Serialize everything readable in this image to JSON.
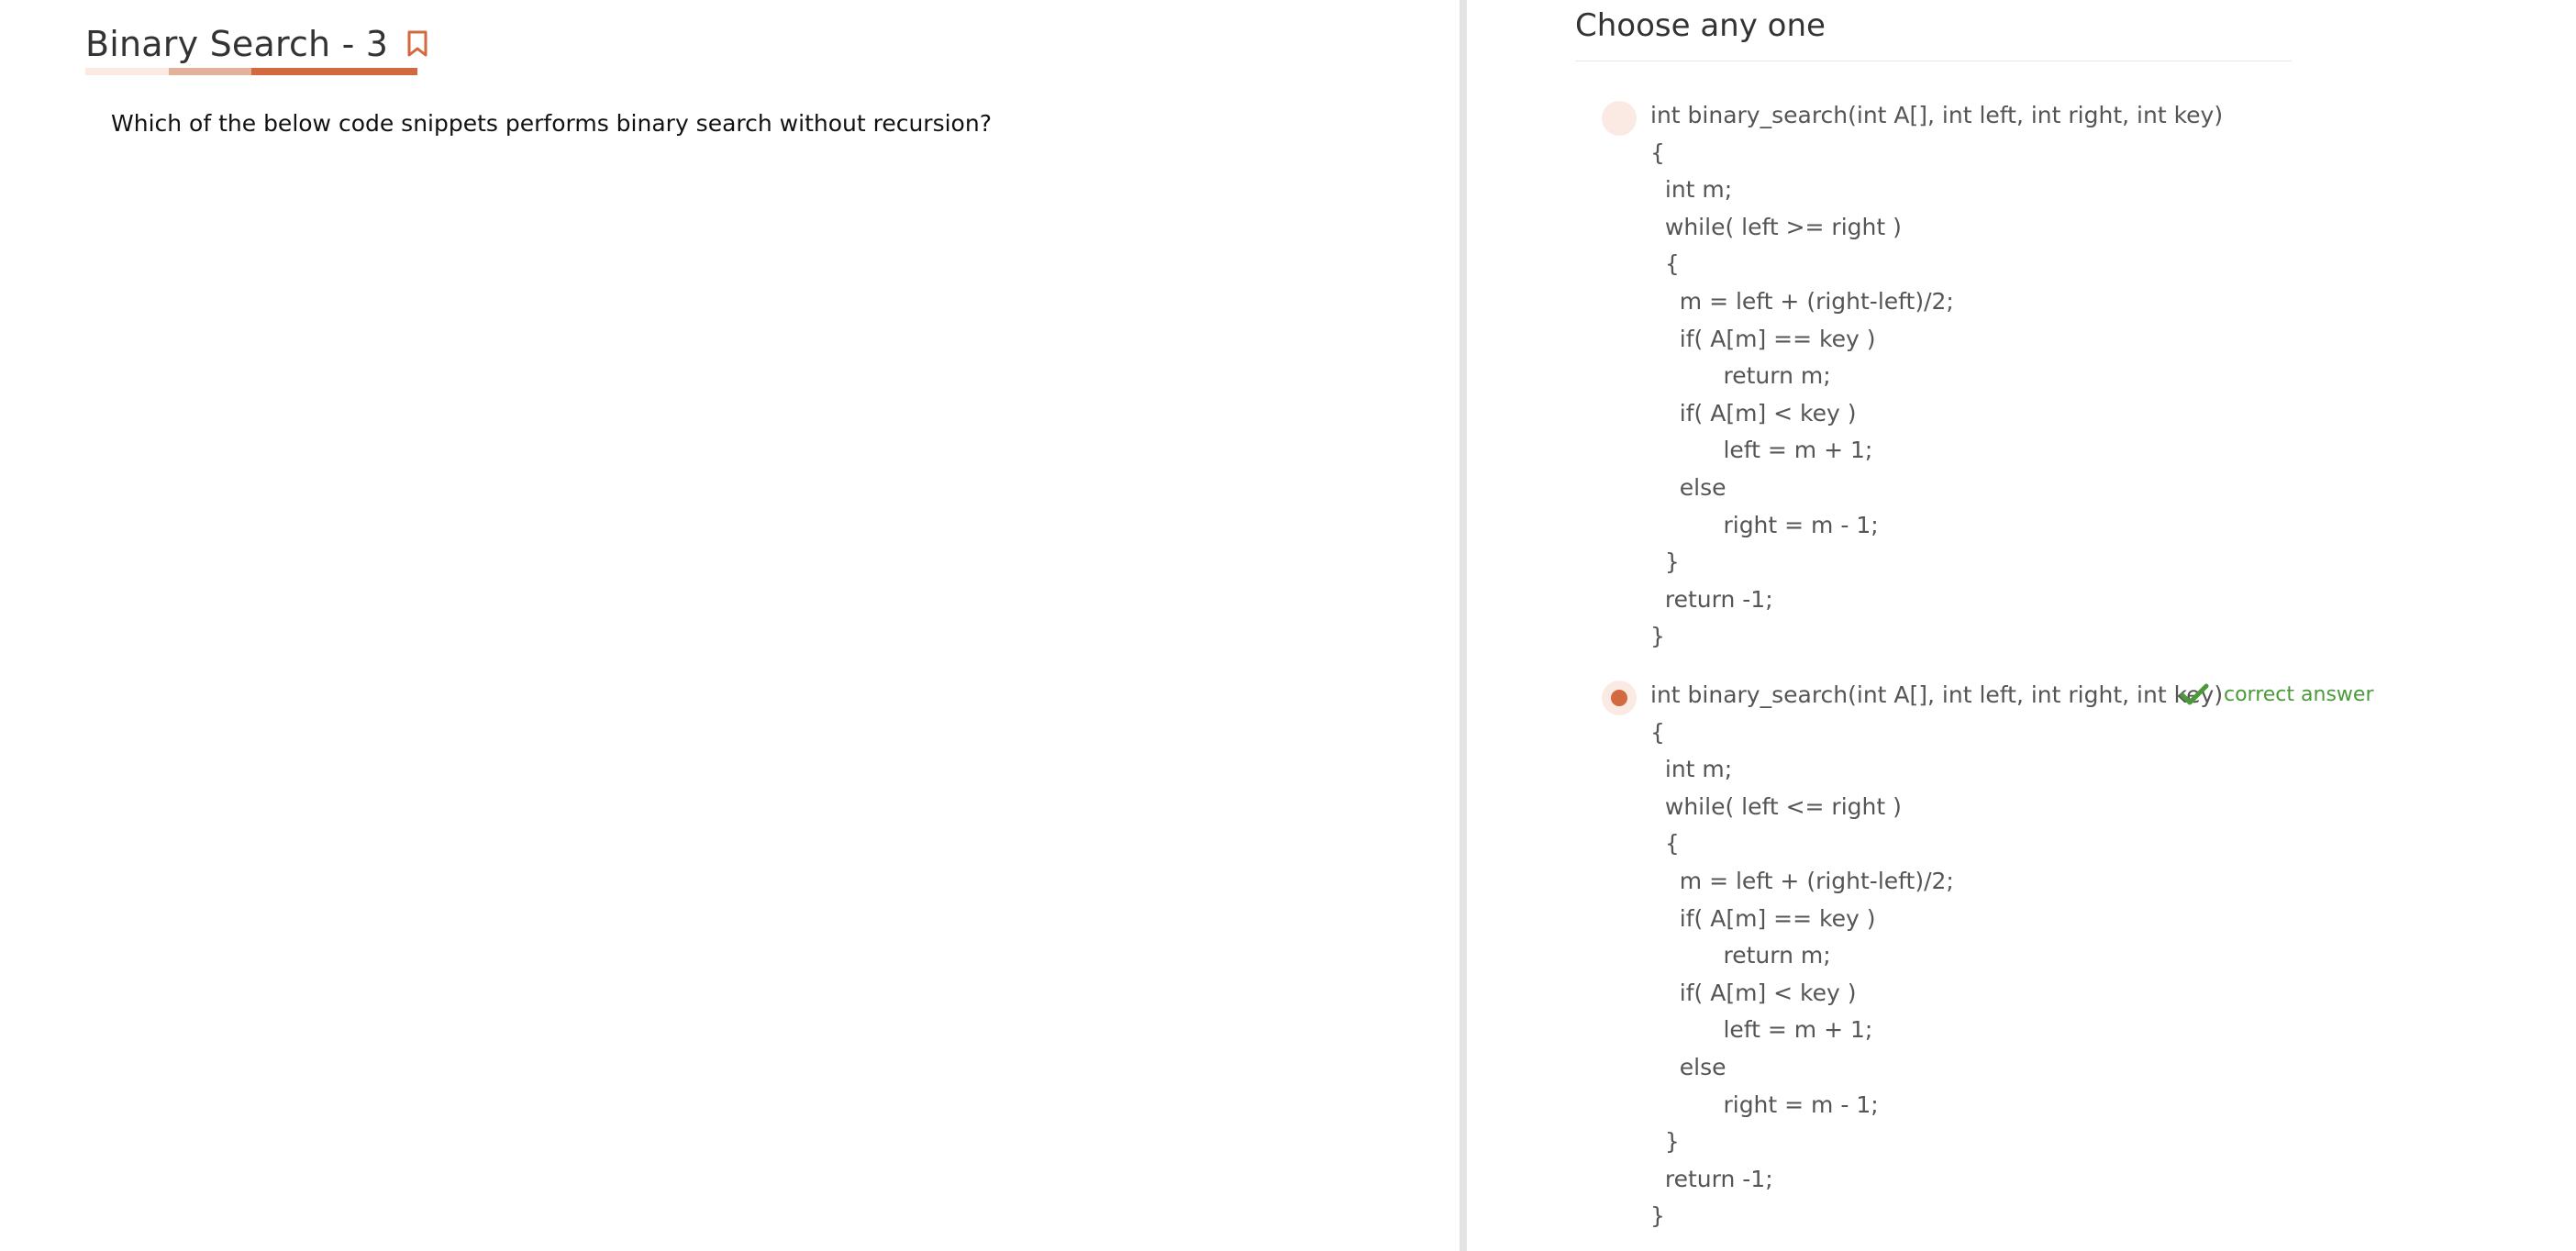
{
  "question": {
    "title": "Binary Search - 3",
    "text": "Which of the below code snippets performs binary search without recursion?",
    "difficulty_colors": [
      "#fbe9e2",
      "#e2b39a",
      "#d2693f",
      "#d2693f"
    ]
  },
  "answers": {
    "header": "Choose any one",
    "options": [
      {
        "selected": false,
        "lines": [
          "int binary_search(int A[], int left, int right, int key)",
          "{",
          "  int m;",
          "  while( left >= right )",
          "  {",
          "    m = left + (right-left)/2;",
          "    if( A[m] == key )",
          "          return m;",
          "    if( A[m] < key )",
          "          left = m + 1;",
          "    else",
          "          right = m - 1;",
          "  }",
          "  return -1;",
          "}"
        ]
      },
      {
        "selected": true,
        "correct_label": "correct answer",
        "lines": [
          "int binary_search(int A[], int left, int right, int key)",
          "{",
          "  int m;",
          "  while( left <= right )",
          "  {",
          "    m = left + (right-left)/2;",
          "    if( A[m] == key )",
          "          return m;",
          "    if( A[m] < key )",
          "          left = m + 1;",
          "    else",
          "          right = m - 1;",
          "  }",
          "  return -1;",
          "}"
        ]
      }
    ]
  },
  "colors": {
    "accent": "#d2693f",
    "correct": "#4a9a3a",
    "radio_bg": "#fbeae3"
  }
}
